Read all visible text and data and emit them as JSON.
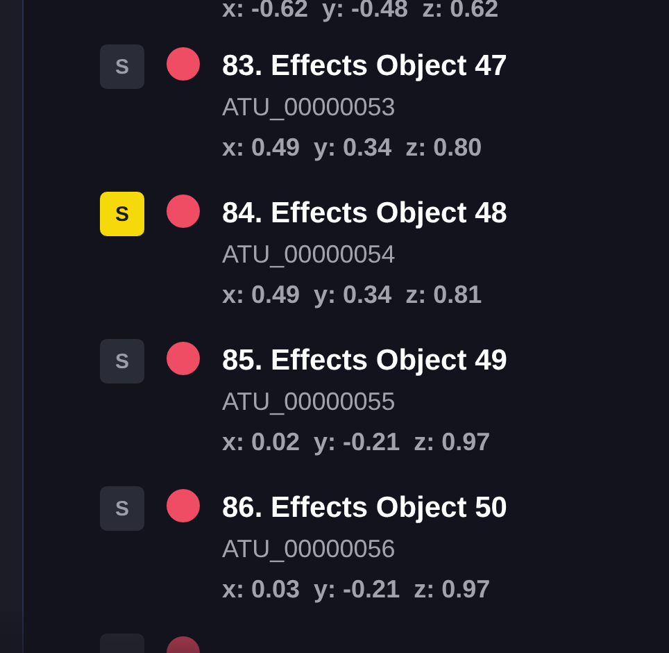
{
  "objects": [
    {
      "coords": "x: -0.62  y: -0.48  z: 0.62"
    },
    {
      "badge": "S",
      "selected": false,
      "title": "83. Effects Object 47",
      "code": "ATU_00000053",
      "coords": "x: 0.49  y: 0.34  z: 0.80"
    },
    {
      "badge": "S",
      "selected": true,
      "title": "84. Effects Object 48",
      "code": "ATU_00000054",
      "coords": "x: 0.49  y: 0.34  z: 0.81"
    },
    {
      "badge": "S",
      "selected": false,
      "title": "85. Effects Object 49",
      "code": "ATU_00000055",
      "coords": "x: 0.02  y: -0.21  z: 0.97"
    },
    {
      "badge": "S",
      "selected": false,
      "title": "86. Effects Object 50",
      "code": "ATU_00000056",
      "coords": "x: 0.03  y: -0.21  z: 0.97"
    },
    {
      "selected": false
    }
  ]
}
